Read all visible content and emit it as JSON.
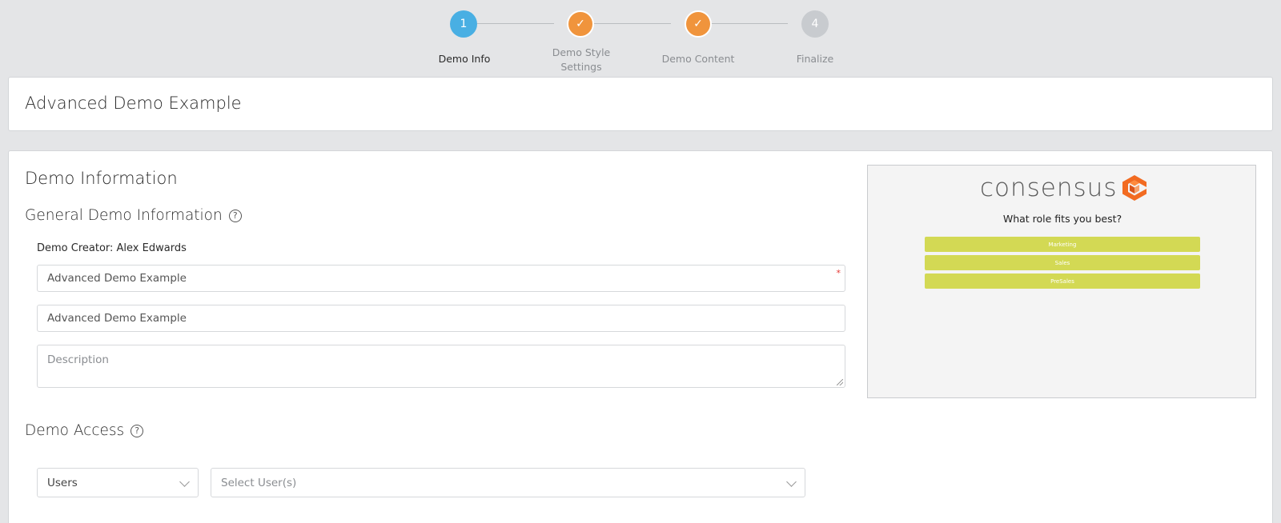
{
  "stepper": {
    "steps": [
      {
        "marker": "1",
        "label": "Demo Info",
        "state": "active"
      },
      {
        "marker": "✓",
        "label_line1": "Demo Style",
        "label_line2": "Settings",
        "state": "done"
      },
      {
        "marker": "✓",
        "label": "Demo Content",
        "state": "done"
      },
      {
        "marker": "4",
        "label": "Finalize",
        "state": "pending"
      }
    ]
  },
  "page": {
    "title": "Advanced Demo Example"
  },
  "demo_info": {
    "section_title": "Demo Information",
    "general_title": "General Demo Information",
    "creator": "Demo Creator: Alex Edwards",
    "name_value": "Advanced Demo Example",
    "required_mark": "*",
    "display_name_value": "Advanced Demo Example",
    "description_placeholder": "Description"
  },
  "access": {
    "title": "Demo Access",
    "type_value": "Users",
    "users_placeholder": "Select User(s)"
  },
  "preview": {
    "logo_text": "consensus",
    "question": "What role fits you best?",
    "options": [
      "Marketing",
      "Sales",
      "PreSales"
    ]
  },
  "colors": {
    "active_step": "#49afe3",
    "done_step": "#f0943c",
    "pending_step": "#c8cbcf",
    "preview_button": "#d3d954",
    "logo_orange": "#f26b21"
  }
}
